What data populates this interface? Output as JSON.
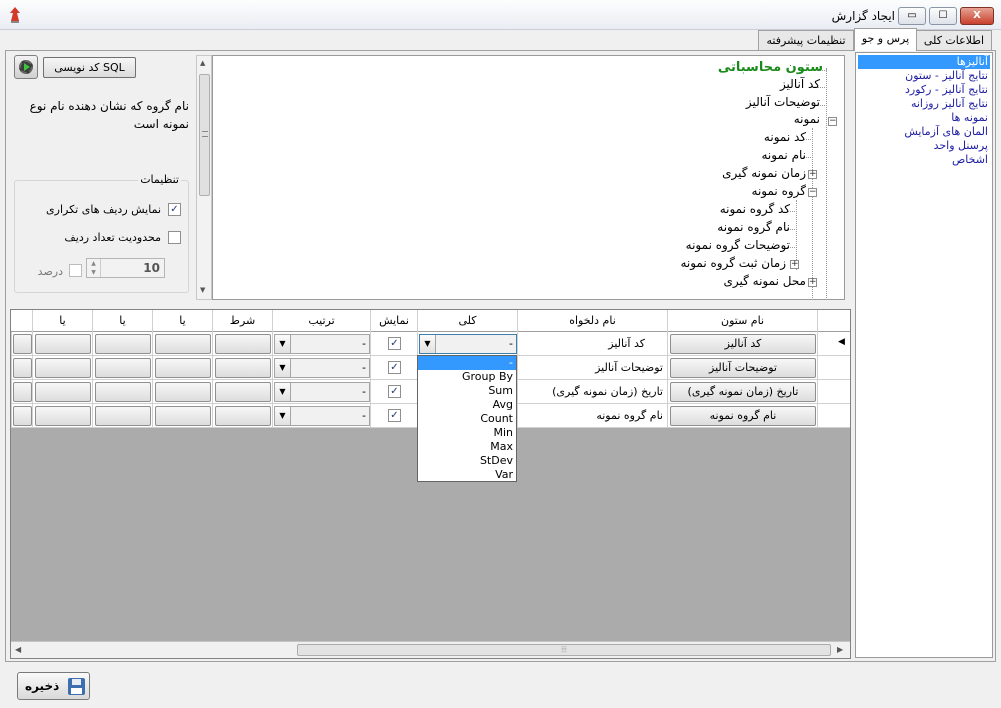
{
  "window": {
    "title": "ایجاد گزارش",
    "min_label": "▭",
    "max_label": "☐",
    "close_label": "X"
  },
  "tabs": [
    "اطلاعات کلی",
    "پرس و جو",
    "تنظیمات پیشرفته"
  ],
  "toolbar": {
    "sql_button": "کد نویسی SQL"
  },
  "hint_text": "نام گروه که نشان دهنده نام نوع نمونه است",
  "settings": {
    "legend": "تنظیمات",
    "show_duplicates_label": "نمایش ردیف های تکراری",
    "show_duplicates_checked": true,
    "limit_rows_label": "محدودیت تعداد ردیف",
    "limit_rows_checked": false,
    "percent_label": "درصد",
    "percent_checked": false,
    "row_limit_value": "10"
  },
  "tree": {
    "root": "ستون محاسباتی",
    "nodes": [
      "کد آنالیز",
      "توضیحات آنالیز",
      "نمونه",
      "کد نمونه",
      "نام نمونه",
      "زمان نمونه گیری",
      "گروه نمونه",
      "کد گروه نمونه",
      "نام گروه نمونه",
      "توضیحات گروه نمونه",
      "زمان ثبت گروه نمونه",
      "محل نمونه گیری"
    ]
  },
  "grid": {
    "headers": [
      "نام ستون",
      "نام دلخواه",
      "کلی",
      "نمایش",
      "ترتیب",
      "شرط",
      "یا",
      "یا",
      "یا"
    ],
    "rows": [
      {
        "column": "کد آنالیز",
        "alias": "کد آنالیز",
        "aggregate": "-",
        "show": true,
        "order": "-"
      },
      {
        "column": "توضیحات آنالیز",
        "alias": "توضیحات آنالیز",
        "aggregate": "",
        "show": true,
        "order": "-"
      },
      {
        "column": "تاریخ (زمان نمونه گیری)",
        "alias": "تاریخ (زمان نمونه گیری)",
        "aggregate": "",
        "show": true,
        "order": "-"
      },
      {
        "column": "نام گروه نمونه",
        "alias": "نام گروه نمونه",
        "aggregate": "",
        "show": true,
        "order": "-"
      }
    ],
    "current_row_marker": "◀",
    "hscroll_grip": "⦙⦙⦙"
  },
  "aggregate_dropdown": {
    "options": [
      "-",
      "Group By",
      "Sum",
      "Avg",
      "Count",
      "Min",
      "Max",
      "StDev",
      "Var"
    ],
    "selected": "-"
  },
  "side_list": [
    "آنالیزها",
    "نتایج آنالیز - ستون",
    "نتایج آنالیز - رکورد",
    "نتایج آنالیز روزانه",
    "نمونه ها",
    "المان های آزمایش",
    "پرسنل واحد",
    "اشخاص"
  ],
  "save_button": "ذخیره",
  "colors": {
    "selection": "#3399ff",
    "tree_root": "#1a8a1a",
    "link_text": "#1d1da3"
  }
}
